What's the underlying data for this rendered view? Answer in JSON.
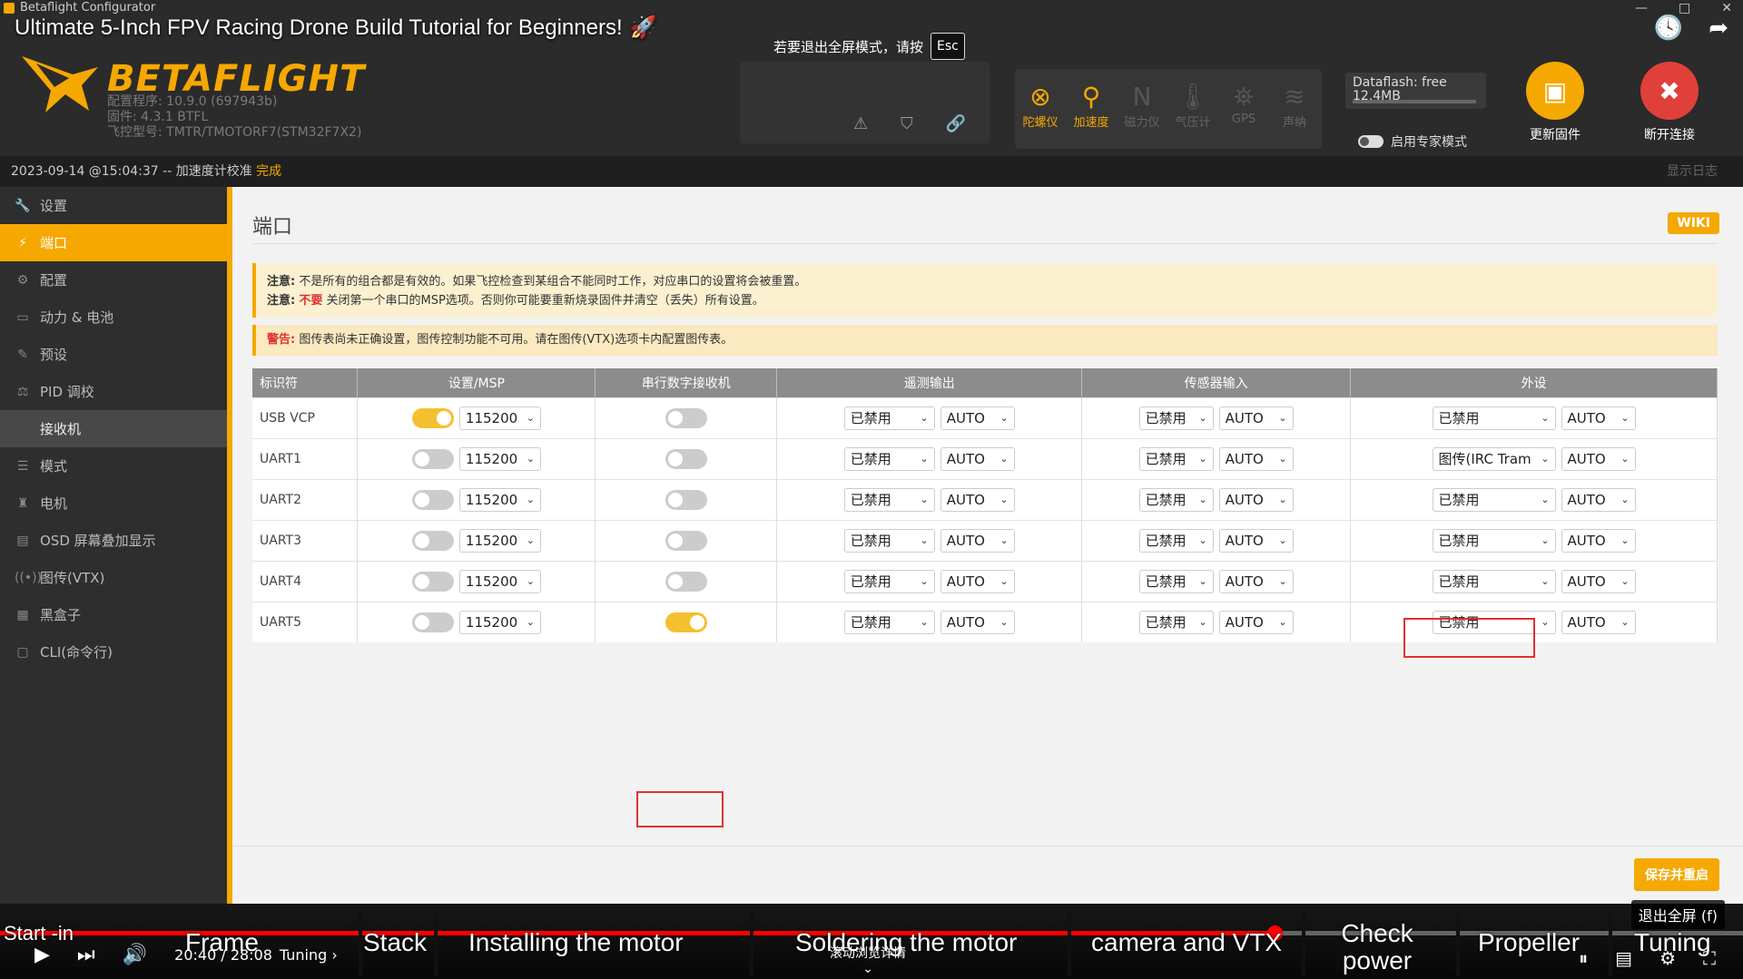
{
  "window": {
    "title": "Betaflight Configurator",
    "controls": [
      "—",
      "□",
      "✕"
    ]
  },
  "video": {
    "title": "Ultimate 5-Inch FPV Racing Drone Build Tutorial for Beginners!",
    "rocket": "🚀",
    "esc_hint": "若要退出全屏模式，请按",
    "esc_key": "Esc",
    "exit_fullscreen": "退出全屏 (f)",
    "scroll_hint": "滚动浏览详情",
    "time": "20:40 / 28:08",
    "chapter_current": "Tuning ›",
    "progress_fraction": 0.731,
    "chapters": [
      "Start -in",
      "Frame",
      "Stack",
      "Installing the motor",
      "Soldering the motor",
      "camera and VTX",
      "Check power",
      "Propeller",
      "Tuning"
    ]
  },
  "header": {
    "logo": "BETAFLIGHT",
    "fw_lines": [
      "配置程序: 10.9.0 (697943b)",
      "固件: 4.3.1 BTFL",
      "飞控型号: TMTR/TMOTORF7(STM32F7X2)"
    ],
    "sensors": [
      {
        "label": "陀螺仪",
        "icon": "gyro-icon",
        "glyph": "⊗",
        "on": true
      },
      {
        "label": "加速度",
        "icon": "accel-icon",
        "glyph": "⚲",
        "on": true
      },
      {
        "label": "磁力仪",
        "icon": "mag-icon",
        "glyph": "N",
        "on": false
      },
      {
        "label": "气压计",
        "icon": "baro-icon",
        "glyph": "🌡",
        "on": false
      },
      {
        "label": "GPS",
        "icon": "gps-icon",
        "glyph": "⛯",
        "on": false
      },
      {
        "label": "声纳",
        "icon": "sonar-icon",
        "glyph": "≋",
        "on": false
      }
    ],
    "dataflash": "Dataflash: free",
    "dataflash_size": "12.4MB",
    "expert_mode": "启用专家模式",
    "update_fw": "更新固件",
    "disconnect": "断开连接"
  },
  "log": {
    "timestamp": "2023-09-14 @15:04:37 -- 加速度计校准",
    "status": "完成",
    "show_log": "显示日志"
  },
  "sidebar": [
    {
      "label": "设置",
      "icon": "wrench-icon",
      "glyph": "🔧",
      "state": ""
    },
    {
      "label": "端口",
      "icon": "plug-icon",
      "glyph": "⚡",
      "state": "active"
    },
    {
      "label": "配置",
      "icon": "gear-icon",
      "glyph": "⚙",
      "state": ""
    },
    {
      "label": "动力 & 电池",
      "icon": "battery-icon",
      "glyph": "▭",
      "state": ""
    },
    {
      "label": "预设",
      "icon": "preset-icon",
      "glyph": "✎",
      "state": ""
    },
    {
      "label": "PID 调校",
      "icon": "pid-icon",
      "glyph": "⚖",
      "state": ""
    },
    {
      "label": "接收机",
      "icon": "receiver-icon",
      "glyph": "",
      "state": "hover"
    },
    {
      "label": "模式",
      "icon": "modes-icon",
      "glyph": "☰",
      "state": ""
    },
    {
      "label": "电机",
      "icon": "motor-icon",
      "glyph": "♜",
      "state": ""
    },
    {
      "label": "OSD 屏幕叠加显示",
      "icon": "osd-icon",
      "glyph": "▤",
      "state": ""
    },
    {
      "label": "图传(VTX)",
      "icon": "vtx-icon",
      "glyph": "((•))",
      "state": ""
    },
    {
      "label": "黑盒子",
      "icon": "blackbox-icon",
      "glyph": "▦",
      "state": ""
    },
    {
      "label": "CLI(命令行)",
      "icon": "cli-icon",
      "glyph": "▢",
      "state": ""
    }
  ],
  "main": {
    "title": "端口",
    "wiki": "WIKI",
    "note1_label": "注意:",
    "note1": "不是所有的组合都是有效的。如果飞控检查到某组合不能同时工作，对应串口的设置将会被重置。",
    "note2_label": "注意:",
    "note2_red": "不要",
    "note2": "关闭第一个串口的MSP选项。否则你可能要重新烧录固件并清空（丢失）所有设置。",
    "warn_label": "警告:",
    "warn": "图传表尚未正确设置，图传控制功能不可用。请在图传(VTX)选项卡内配置图传表。",
    "save_button": "保存并重启"
  },
  "ports": {
    "headers": [
      "标识符",
      "设置/MSP",
      "串行数字接收机",
      "遥测输出",
      "传感器输入",
      "外设"
    ],
    "rows": [
      {
        "id": "USB VCP",
        "msp": true,
        "baud": "115200",
        "rx": false,
        "tel": "已禁用",
        "tel_baud": "AUTO",
        "sen": "已禁用",
        "sen_baud": "AUTO",
        "per": "已禁用",
        "per_baud": "AUTO"
      },
      {
        "id": "UART1",
        "msp": false,
        "baud": "115200",
        "rx": false,
        "tel": "已禁用",
        "tel_baud": "AUTO",
        "sen": "已禁用",
        "sen_baud": "AUTO",
        "per": "图传(IRC Tram",
        "per_baud": "AUTO"
      },
      {
        "id": "UART2",
        "msp": false,
        "baud": "115200",
        "rx": false,
        "tel": "已禁用",
        "tel_baud": "AUTO",
        "sen": "已禁用",
        "sen_baud": "AUTO",
        "per": "已禁用",
        "per_baud": "AUTO"
      },
      {
        "id": "UART3",
        "msp": false,
        "baud": "115200",
        "rx": false,
        "tel": "已禁用",
        "tel_baud": "AUTO",
        "sen": "已禁用",
        "sen_baud": "AUTO",
        "per": "已禁用",
        "per_baud": "AUTO"
      },
      {
        "id": "UART4",
        "msp": false,
        "baud": "115200",
        "rx": false,
        "tel": "已禁用",
        "tel_baud": "AUTO",
        "sen": "已禁用",
        "sen_baud": "AUTO",
        "per": "已禁用",
        "per_baud": "AUTO"
      },
      {
        "id": "UART5",
        "msp": false,
        "baud": "115200",
        "rx": true,
        "tel": "已禁用",
        "tel_baud": "AUTO",
        "sen": "已禁用",
        "sen_baud": "AUTO",
        "per": "已禁用",
        "per_baud": "AUTO"
      }
    ]
  },
  "colors": {
    "accent": "#f5a800",
    "highlight": "#e03030",
    "progress": "#ff0000"
  }
}
